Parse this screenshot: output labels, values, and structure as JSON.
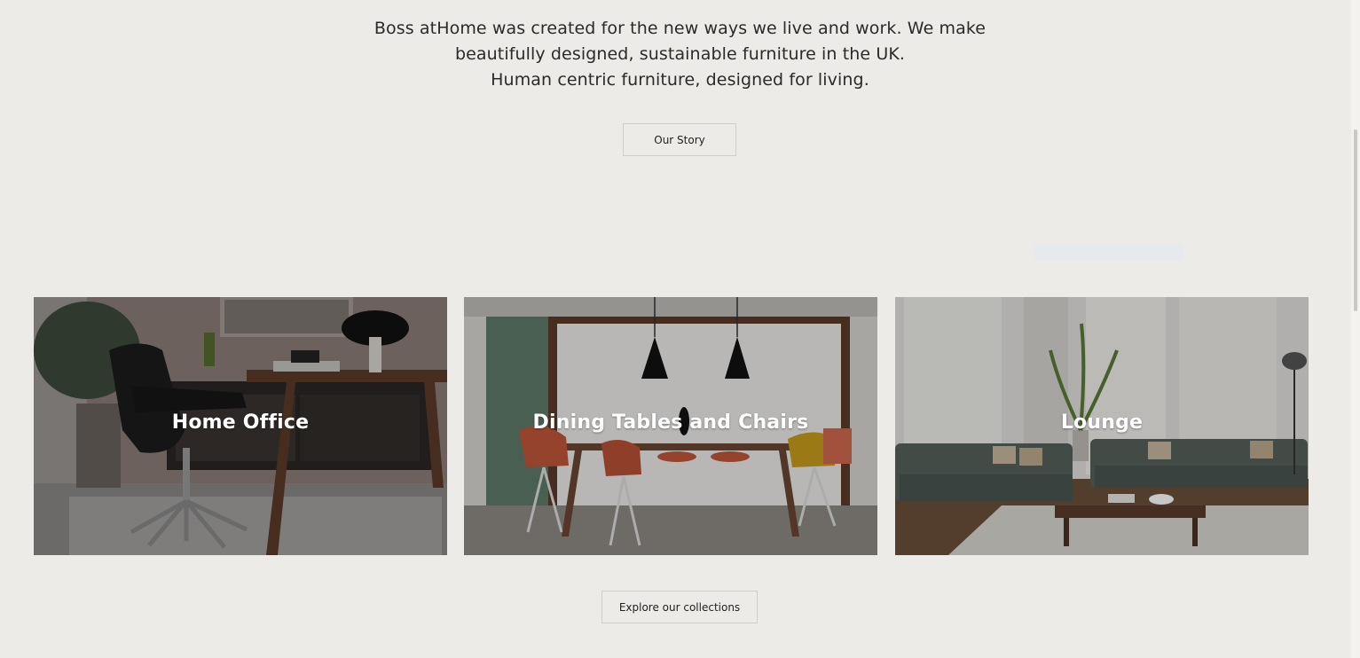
{
  "intro": {
    "lines": [
      "Boss atHome was created for the new ways we live and work. We make",
      "beautifully designed, sustainable furniture in the UK.",
      "Human centric furniture, designed for living."
    ],
    "our_story_label": "Our Story"
  },
  "collections": [
    {
      "title": "Home Office"
    },
    {
      "title": "Dining Tables and Chairs"
    },
    {
      "title": "Lounge"
    }
  ],
  "explore_label": "Explore our collections",
  "colors": {
    "background": "#edebe7",
    "button_border": "#cfcdc9",
    "card_title": "#ffffff"
  }
}
